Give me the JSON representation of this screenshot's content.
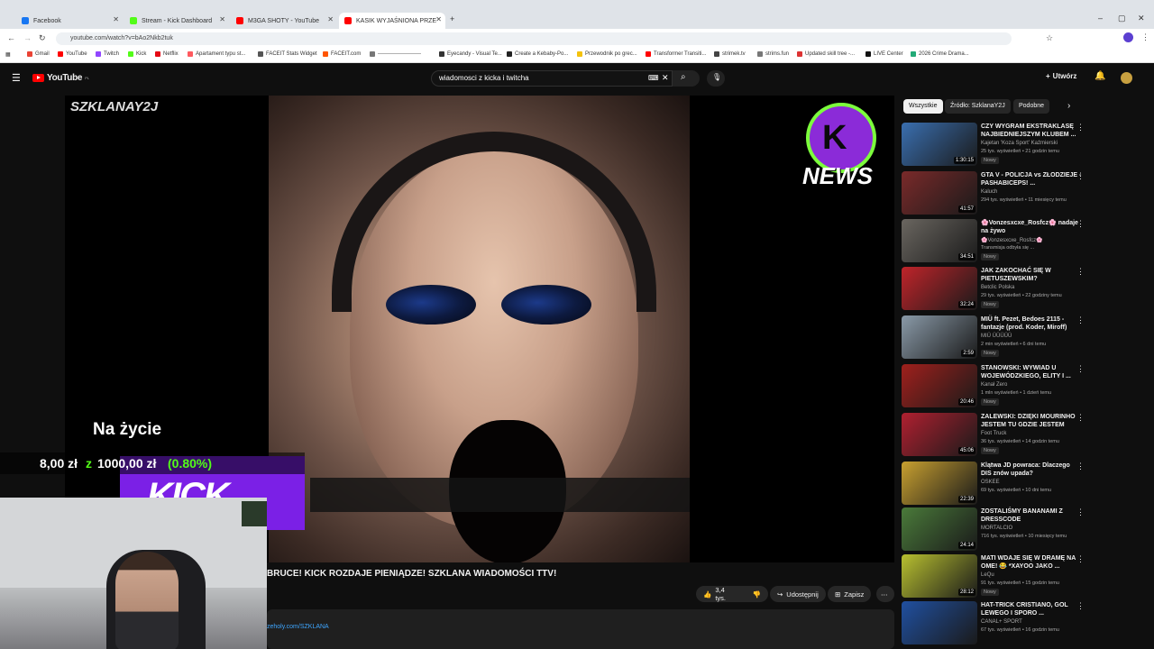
{
  "browser": {
    "tabs": [
      {
        "label": "Facebook",
        "color": "#1877f2"
      },
      {
        "label": "Stream - Kick Dashboard",
        "color": "#53fc18"
      },
      {
        "label": "M3GA SHOTY - YouTube",
        "color": "#ff0000"
      },
      {
        "label": "KASIK WYJAŚNIONA PRZE",
        "color": "#ff0000"
      }
    ],
    "url": "youtube.com/watch?v=bAo2Nkb2tuk",
    "bookmarks": [
      "Gmail",
      "YouTube",
      "Twitch",
      "Kick",
      "Netflix",
      "Apartament typu st...",
      "FACEIT Stats Widget",
      "FACEIT.com",
      "------------------------",
      "Eyecandy - Visual Te...",
      "Create a Kebaby-Po...",
      "Przewodnik po grec...",
      "Transformer Transiti...",
      "strimek.tv",
      "strims.fun",
      "Updated skill tree -...",
      "LIVE Center",
      "2026 Crime Drama..."
    ]
  },
  "youtube": {
    "logo": "YouTube",
    "logo_suffix": "PL",
    "search_value": "wiadomosci z kicka i twitcha",
    "create_label": "Utwórz"
  },
  "video": {
    "corner_logo": "SZKLANAY2J",
    "news_logo": "NEWS",
    "overlay_title": "Na życie",
    "donation_amount": "8,00 zł",
    "donation_of": "z",
    "donation_goal": "1000,00 zł",
    "donation_percent": "(0.80%)",
    "kick_text": "KICK",
    "title": "BRUCE! KICK ROZDAJE PIENIĄDZE! SZKLANA WIADOMOŚCI TTV!",
    "likes": "3,4 tys.",
    "share_label": "Udostępnij",
    "save_label": "Zapisz",
    "desc_link": "zeholy.com/SZKLANA"
  },
  "sidebar": {
    "chips": [
      "Wszystkie",
      "Źródło: SzklanaY2J",
      "Podobne"
    ],
    "recommendations": [
      {
        "title": "CZY WYGRAM EKSTRAKLASĘ NAJBIEDNIEJSZYM KLUBEM ...",
        "channel": "Kajetan 'Koza Sport' Kaźmierski",
        "meta": "25 tys. wyświetleń • 21 godzin temu",
        "duration": "1:30:15",
        "new": "Nowy",
        "color": "#3a6fb0"
      },
      {
        "title": "GTA V - POLICJA vs ZŁODZIEJE - PASHABICEPS! ...",
        "channel": "Kaluch",
        "meta": "294 tys. wyświetleń • 11 miesięcy temu",
        "duration": "41:57",
        "new": "",
        "color": "#7a2a2a"
      },
      {
        "title": "🌸Vonzesxcxe_Rosfcz🌸 nadaje na żywo",
        "channel": "🌸Vonzesxcxe_Rosfcz🌸",
        "meta": "Transmisja odbyła się ...",
        "duration": "34:51",
        "new": "Nowy",
        "color": "#6a6660"
      },
      {
        "title": "JAK ZAKOCHAĆ SIĘ W PIETUSZEWSKIM?",
        "channel": "Betclic Polska",
        "meta": "29 tys. wyświetleń • 22 godziny temu",
        "duration": "32:24",
        "new": "Nowy",
        "color": "#c0242a"
      },
      {
        "title": "MIÜ ft. Pezet, Bedoes 2115 - fantazje (prod. Koder, Miroff)",
        "channel": "MIÜ ÜÜÜÜÜ",
        "meta": "2 min wyświetleń • 6 dni temu",
        "duration": "2:59",
        "new": "Nowy",
        "color": "#8a9aa8"
      },
      {
        "title": "STANOWSKI: WYWIAD U WOJEWÓDZKIEGO, ELITY I ...",
        "channel": "Kanał Zero",
        "meta": "1 mln wyświetleń • 1 dzień temu",
        "duration": "20:46",
        "new": "Nowy",
        "color": "#a0201c"
      },
      {
        "title": "ZALEWSKI: DZIĘKI MOURINHO JESTEM TU GDZIE JESTEM",
        "channel": "Foot Truck",
        "meta": "36 tys. wyświetleń • 14 godzin temu",
        "duration": "45:06",
        "new": "Nowy",
        "color": "#b02030"
      },
      {
        "title": "Klątwa JD powraca: Dlaczego DIS znów upada?",
        "channel": "OSKEE",
        "meta": "69 tys. wyświetleń • 10 dni temu",
        "duration": "22:39",
        "new": "",
        "color": "#c8a030"
      },
      {
        "title": "ZOSTALIŚMY BANANAMI Z DRESSCODE",
        "channel": "MORTALCIO",
        "meta": "716 tys. wyświetleń • 10 miesięcy temu",
        "duration": "24:14",
        "new": "",
        "color": "#4a7a3a"
      },
      {
        "title": "MATI WDAJE SIĘ W DRAMĘ NA OME! 😂 *XAYOO JAKO ...",
        "channel": "LeQu",
        "meta": "91 tys. wyświetleń • 15 godzin temu",
        "duration": "28:12",
        "new": "Nowy",
        "color": "#b8c030"
      },
      {
        "title": "HAT-TRICK CRISTIANO, GOL LEWEGO I SPORO ...",
        "channel": "CANAL+ SPORT",
        "meta": "67 tys. wyświetleń • 16 godzin temu",
        "duration": "",
        "new": "",
        "color": "#2050a0"
      }
    ]
  }
}
